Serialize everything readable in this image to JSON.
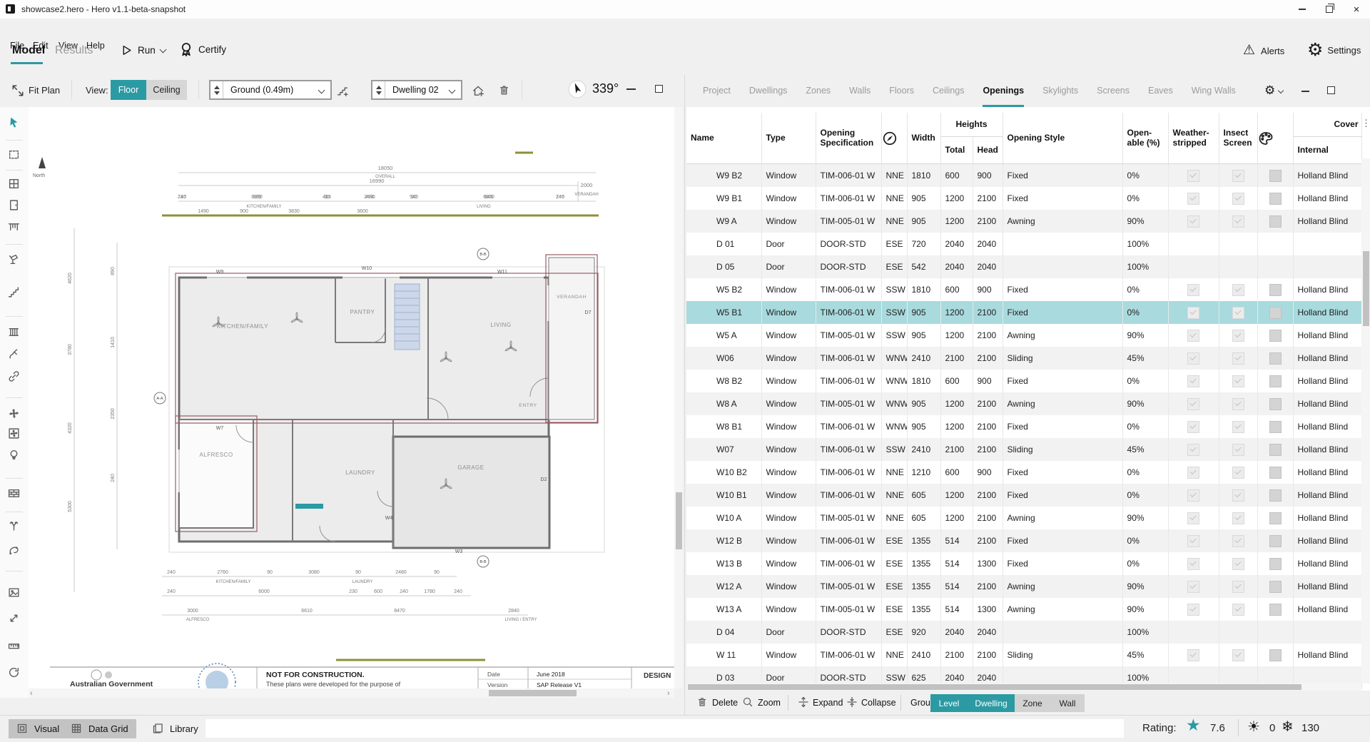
{
  "window": {
    "title": "showcase2.hero - Hero v1.1-beta-snapshot"
  },
  "menu": [
    "File",
    "Edit",
    "View",
    "Help"
  ],
  "primary_tabs": [
    {
      "label": "Model",
      "active": true
    },
    {
      "label": "Results",
      "active": false
    }
  ],
  "actions": {
    "run": "Run",
    "certify": "Certify"
  },
  "topright": {
    "alerts": "Alerts",
    "settings": "Settings"
  },
  "plan_toolbar": {
    "fit_plan": "Fit Plan",
    "view_label": "View:",
    "floor": "Floor",
    "ceiling": "Ceiling",
    "level_value": "Ground (0.49m)",
    "dwelling_value": "Dwelling 02",
    "rotation": "339°"
  },
  "left_toolbar": {
    "tools": [
      "select-tool",
      "zone-tool",
      "window-tool",
      "door-tool",
      "shade-tool",
      "spray-tool",
      "stairs-tool",
      "heater-tool",
      "hose-tool",
      "link-tool",
      "fan-tool",
      "exhaust-fan-tool",
      "light-tool",
      "masonry-tool",
      "split-tool",
      "lasso-tool",
      "image-tool",
      "resize-tool",
      "measure-tool",
      "reset-view-tool"
    ]
  },
  "plan": {
    "north": "North",
    "rooms": {
      "kitchen": "KITCHEN/FAMILY",
      "pantry": "PANTRY",
      "living": "LIVING",
      "verandah": "VERANDAH",
      "alfresco": "ALFRESCO",
      "laundry": "LAUNDRY",
      "garage": "GARAGE",
      "entry": "ENTRY"
    },
    "dims": {
      "overall": "18050",
      "overall_label": "OVERALL",
      "second": "16990",
      "top": [
        "240",
        "6990",
        "90",
        "2480",
        "90",
        "6830",
        "240"
      ],
      "top_rooms": [
        "KITCHEN/FAMILY",
        "LIVING"
      ],
      "top2": [
        "1490",
        "900",
        "3830",
        "3600"
      ],
      "verandah": [
        "2000",
        "VERANDAH"
      ],
      "left_outer": [
        "4620",
        "3780",
        "4320",
        "5300"
      ],
      "left_inner": [
        "890",
        "1410",
        "2350",
        "240"
      ],
      "bottom1": [
        "240",
        "2760",
        "90",
        "3080",
        "90",
        "2480",
        "90"
      ],
      "bottom1_rooms": [
        "KITCHEN/FAMILY",
        "LAUNDRY"
      ],
      "bottom2": [
        "240",
        "6000",
        "230",
        "600",
        "240",
        "1780",
        "240"
      ],
      "bottom3": [
        "3000",
        "6610",
        "8470",
        "2840"
      ],
      "bottom3_rooms": [
        "ALFRESCO",
        "LIVING / ENTRY"
      ]
    },
    "tags": [
      "W9",
      "W10",
      "W11",
      "W7",
      "W3",
      "W4",
      "D2",
      "D7"
    ],
    "sections": [
      "A-A",
      "B-B",
      "B-B"
    ],
    "title_block": {
      "org": "Australian Government",
      "warning": "NOT FOR CONSTRUCTION.",
      "purpose": "These plans were developed for the purpose of",
      "date_label": "Date",
      "date": "June 2018",
      "version_label": "Version",
      "version": "SAP Release V1",
      "next_panel": "DESIGN"
    }
  },
  "right_panel": {
    "tabs": [
      "Project",
      "Dwellings",
      "Zones",
      "Walls",
      "Floors",
      "Ceilings",
      "Openings",
      "Skylights",
      "Screens",
      "Eaves",
      "Wing Walls"
    ],
    "active_tab": "Openings"
  },
  "table": {
    "groups": {
      "heights": "Heights",
      "cover": "Cover"
    },
    "columns": [
      {
        "id": "name",
        "label": "Name"
      },
      {
        "id": "type",
        "label": "Type"
      },
      {
        "id": "spec",
        "label": "Opening Specification"
      },
      {
        "id": "orientation",
        "label": "",
        "icon": "compass-icon"
      },
      {
        "id": "width",
        "label": "Width"
      },
      {
        "id": "total",
        "label": "Total",
        "group": "heights"
      },
      {
        "id": "head",
        "label": "Head",
        "group": "heights"
      },
      {
        "id": "style",
        "label": "Opening Style"
      },
      {
        "id": "openable",
        "label": "Open- able (%)"
      },
      {
        "id": "weatherstripped",
        "label": "Weather- stripped"
      },
      {
        "id": "insect",
        "label": "Insect Screen"
      },
      {
        "id": "swatch",
        "label": "",
        "icon": "palette-icon"
      },
      {
        "id": "internal",
        "label": "Internal",
        "group": "cover"
      }
    ],
    "rows": [
      {
        "name": "W9 B2",
        "type": "Window",
        "spec": "TIM-006-01 W",
        "orientation": "NNE",
        "width": "1810",
        "total": "600",
        "head": "900",
        "style": "Fixed",
        "openable": "0%",
        "weatherstripped": true,
        "insect": true,
        "swatch": true,
        "internal": "Holland Blind",
        "selected": false
      },
      {
        "name": "W9 B1",
        "type": "Window",
        "spec": "TIM-006-01 W",
        "orientation": "NNE",
        "width": "905",
        "total": "1200",
        "head": "2100",
        "style": "Fixed",
        "openable": "0%",
        "weatherstripped": true,
        "insect": true,
        "swatch": true,
        "internal": "Holland Blind",
        "selected": false
      },
      {
        "name": "W9 A",
        "type": "Window",
        "spec": "TIM-005-01 W",
        "orientation": "NNE",
        "width": "905",
        "total": "1200",
        "head": "2100",
        "style": "Awning",
        "openable": "90%",
        "weatherstripped": true,
        "insect": true,
        "swatch": true,
        "internal": "Holland Blind",
        "selected": false
      },
      {
        "name": "D 01",
        "type": "Door",
        "spec": "DOOR-STD",
        "orientation": "ESE",
        "width": "720",
        "total": "2040",
        "head": "2040",
        "style": "",
        "openable": "100%",
        "weatherstripped": false,
        "insect": false,
        "swatch": false,
        "internal": "",
        "selected": false
      },
      {
        "name": "D 05",
        "type": "Door",
        "spec": "DOOR-STD",
        "orientation": "ESE",
        "width": "542",
        "total": "2040",
        "head": "2040",
        "style": "",
        "openable": "100%",
        "weatherstripped": false,
        "insect": false,
        "swatch": false,
        "internal": "",
        "selected": false
      },
      {
        "name": "W5 B2",
        "type": "Window",
        "spec": "TIM-006-01 W",
        "orientation": "SSW",
        "width": "1810",
        "total": "600",
        "head": "900",
        "style": "Fixed",
        "openable": "0%",
        "weatherstripped": true,
        "insect": true,
        "swatch": true,
        "internal": "Holland Blind",
        "selected": false
      },
      {
        "name": "W5 B1",
        "type": "Window",
        "spec": "TIM-006-01 W",
        "orientation": "SSW",
        "width": "905",
        "total": "1200",
        "head": "2100",
        "style": "Fixed",
        "openable": "0%",
        "weatherstripped": true,
        "insect": true,
        "swatch": true,
        "internal": "Holland Blind",
        "selected": true
      },
      {
        "name": "W5 A",
        "type": "Window",
        "spec": "TIM-005-01 W",
        "orientation": "SSW",
        "width": "905",
        "total": "1200",
        "head": "2100",
        "style": "Awning",
        "openable": "90%",
        "weatherstripped": true,
        "insect": true,
        "swatch": true,
        "internal": "Holland Blind",
        "selected": false
      },
      {
        "name": "W06",
        "type": "Window",
        "spec": "TIM-006-01 W",
        "orientation": "WNW",
        "width": "2410",
        "total": "2100",
        "head": "2100",
        "style": "Sliding",
        "openable": "45%",
        "weatherstripped": true,
        "insect": true,
        "swatch": true,
        "internal": "Holland Blind",
        "selected": false
      },
      {
        "name": "W8 B2",
        "type": "Window",
        "spec": "TIM-006-01 W",
        "orientation": "WNW",
        "width": "1810",
        "total": "600",
        "head": "900",
        "style": "Fixed",
        "openable": "0%",
        "weatherstripped": true,
        "insect": true,
        "swatch": true,
        "internal": "Holland Blind",
        "selected": false
      },
      {
        "name": "W8 A",
        "type": "Window",
        "spec": "TIM-005-01 W",
        "orientation": "WNW",
        "width": "905",
        "total": "1200",
        "head": "2100",
        "style": "Awning",
        "openable": "90%",
        "weatherstripped": true,
        "insect": true,
        "swatch": true,
        "internal": "Holland Blind",
        "selected": false
      },
      {
        "name": "W8 B1",
        "type": "Window",
        "spec": "TIM-006-01 W",
        "orientation": "WNW",
        "width": "905",
        "total": "1200",
        "head": "2100",
        "style": "Fixed",
        "openable": "0%",
        "weatherstripped": true,
        "insect": true,
        "swatch": true,
        "internal": "Holland Blind",
        "selected": false
      },
      {
        "name": "W07",
        "type": "Window",
        "spec": "TIM-006-01 W",
        "orientation": "SSW",
        "width": "2410",
        "total": "2100",
        "head": "2100",
        "style": "Sliding",
        "openable": "45%",
        "weatherstripped": true,
        "insect": true,
        "swatch": true,
        "internal": "Holland Blind",
        "selected": false
      },
      {
        "name": "W10 B2",
        "type": "Window",
        "spec": "TIM-006-01 W",
        "orientation": "NNE",
        "width": "1210",
        "total": "600",
        "head": "900",
        "style": "Fixed",
        "openable": "0%",
        "weatherstripped": true,
        "insect": true,
        "swatch": true,
        "internal": "Holland Blind",
        "selected": false
      },
      {
        "name": "W10 B1",
        "type": "Window",
        "spec": "TIM-006-01 W",
        "orientation": "NNE",
        "width": "605",
        "total": "1200",
        "head": "2100",
        "style": "Fixed",
        "openable": "0%",
        "weatherstripped": true,
        "insect": true,
        "swatch": true,
        "internal": "Holland Blind",
        "selected": false
      },
      {
        "name": "W10 A",
        "type": "Window",
        "spec": "TIM-005-01 W",
        "orientation": "NNE",
        "width": "605",
        "total": "1200",
        "head": "2100",
        "style": "Awning",
        "openable": "90%",
        "weatherstripped": true,
        "insect": true,
        "swatch": true,
        "internal": "Holland Blind",
        "selected": false
      },
      {
        "name": "W12 B",
        "type": "Window",
        "spec": "TIM-006-01 W",
        "orientation": "ESE",
        "width": "1355",
        "total": "514",
        "head": "2100",
        "style": "Fixed",
        "openable": "0%",
        "weatherstripped": true,
        "insect": true,
        "swatch": true,
        "internal": "Holland Blind",
        "selected": false
      },
      {
        "name": "W13 B",
        "type": "Window",
        "spec": "TIM-006-01 W",
        "orientation": "ESE",
        "width": "1355",
        "total": "514",
        "head": "1300",
        "style": "Fixed",
        "openable": "0%",
        "weatherstripped": true,
        "insect": true,
        "swatch": true,
        "internal": "Holland Blind",
        "selected": false
      },
      {
        "name": "W12 A",
        "type": "Window",
        "spec": "TIM-005-01 W",
        "orientation": "ESE",
        "width": "1355",
        "total": "514",
        "head": "2100",
        "style": "Awning",
        "openable": "90%",
        "weatherstripped": true,
        "insect": true,
        "swatch": true,
        "internal": "Holland Blind",
        "selected": false
      },
      {
        "name": "W13 A",
        "type": "Window",
        "spec": "TIM-005-01 W",
        "orientation": "ESE",
        "width": "1355",
        "total": "514",
        "head": "1300",
        "style": "Awning",
        "openable": "90%",
        "weatherstripped": true,
        "insect": true,
        "swatch": true,
        "internal": "Holland Blind",
        "selected": false
      },
      {
        "name": "D 04",
        "type": "Door",
        "spec": "DOOR-STD",
        "orientation": "ESE",
        "width": "920",
        "total": "2040",
        "head": "2040",
        "style": "",
        "openable": "100%",
        "weatherstripped": false,
        "insect": false,
        "swatch": false,
        "internal": "",
        "selected": false
      },
      {
        "name": "W 11",
        "type": "Window",
        "spec": "TIM-006-01 W",
        "orientation": "NNE",
        "width": "2410",
        "total": "2100",
        "head": "2100",
        "style": "Sliding",
        "openable": "45%",
        "weatherstripped": true,
        "insect": true,
        "swatch": true,
        "internal": "Holland Blind",
        "selected": false
      },
      {
        "name": "D 03",
        "type": "Door",
        "spec": "DOOR-STD",
        "orientation": "SSW",
        "width": "625",
        "total": "2040",
        "head": "2040",
        "style": "",
        "openable": "100%",
        "weatherstripped": false,
        "insect": false,
        "swatch": false,
        "internal": "",
        "selected": false
      }
    ]
  },
  "table_footer": {
    "delete": "Delete",
    "zoom": "Zoom",
    "expand": "Expand",
    "collapse": "Collapse",
    "group_by": "Group by:",
    "groups": [
      {
        "label": "Level",
        "active": true
      },
      {
        "label": "Dwelling",
        "active": true
      },
      {
        "label": "Zone",
        "active": false
      },
      {
        "label": "Wall",
        "active": false
      }
    ]
  },
  "status_bar": {
    "visual": "Visual",
    "data_grid": "Data Grid",
    "library": "Library",
    "rating_label": "Rating:",
    "rating": "7.6",
    "heating": "0",
    "cooling": "130"
  },
  "colors": {
    "accent": "#2b9aa3",
    "selection": "#a9dadd"
  }
}
